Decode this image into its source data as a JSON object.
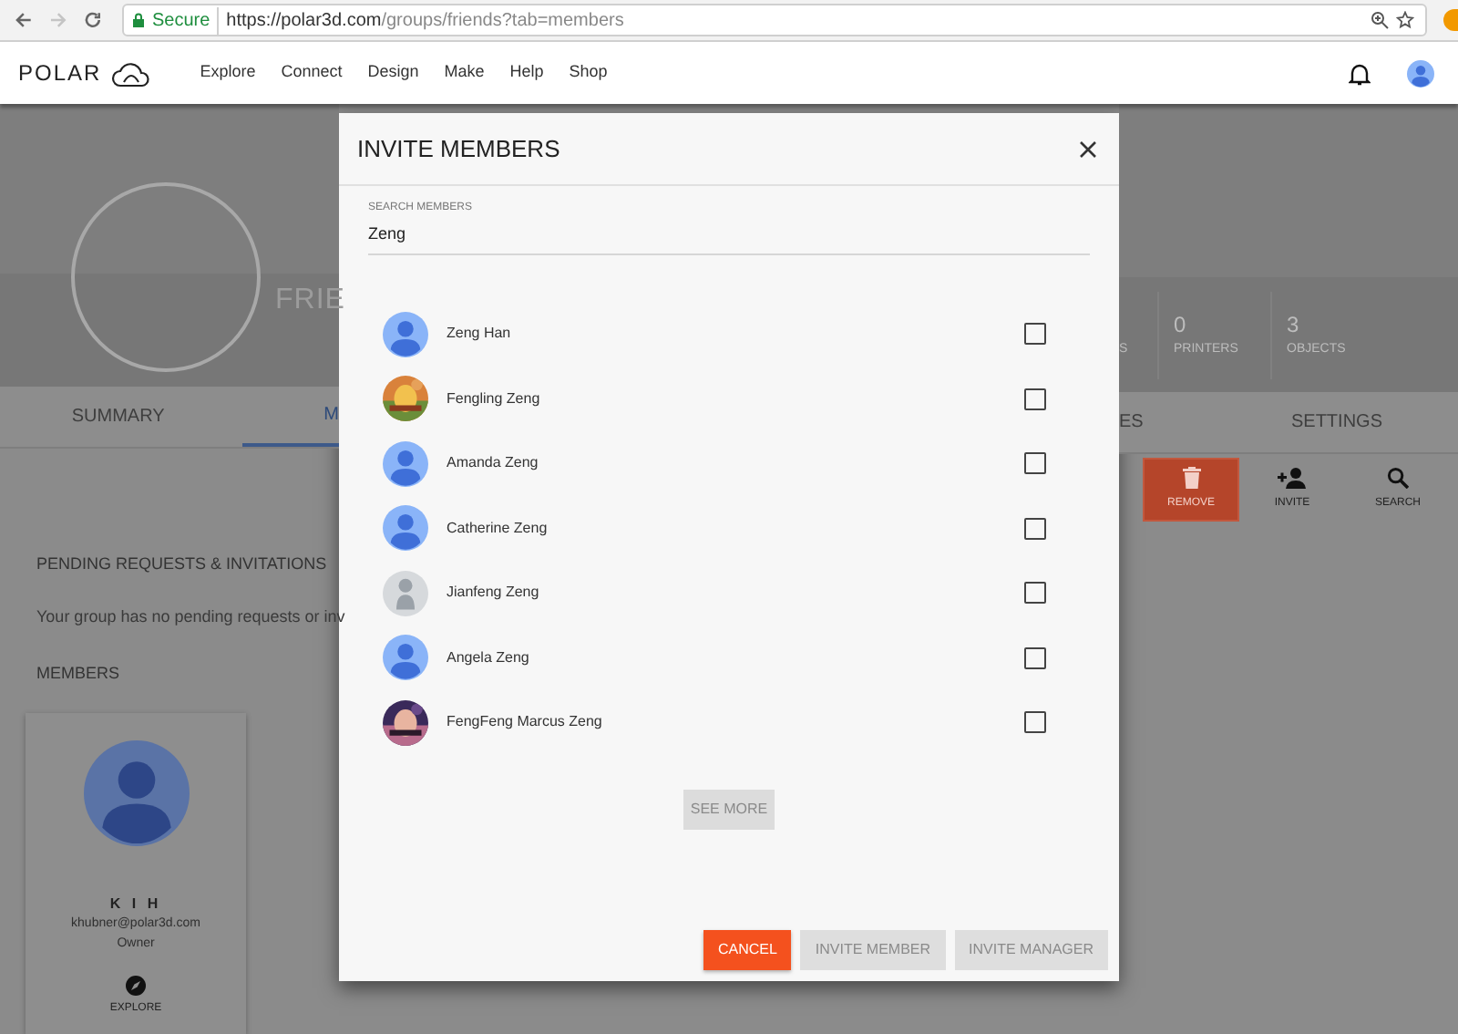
{
  "browser": {
    "secure_label": "Secure",
    "url_host": "https://polar3d.com",
    "url_path": "/groups/friends?tab=members"
  },
  "nav": {
    "logo": "POLAR",
    "links": [
      "Explore",
      "Connect",
      "Design",
      "Make",
      "Help",
      "Shop"
    ]
  },
  "group": {
    "name": "FRIE",
    "stats": [
      {
        "label": "S"
      },
      {
        "value": "0",
        "label": "PRINTERS"
      },
      {
        "value": "3",
        "label": "OBJECTS"
      }
    ]
  },
  "tabs": [
    {
      "label": "SUMMARY",
      "selected": false
    },
    {
      "label": "M",
      "selected": true
    },
    {
      "label": "ES",
      "selected": false
    },
    {
      "label": "SETTINGS",
      "selected": false
    }
  ],
  "actions": [
    {
      "label": "REMOVE",
      "kind": "remove"
    },
    {
      "label": "INVITE",
      "kind": "invite"
    },
    {
      "label": "SEARCH",
      "kind": "search"
    }
  ],
  "pending": {
    "heading": "PENDING REQUESTS & INVITATIONS",
    "text": "Your group has no pending requests or inv"
  },
  "members": {
    "heading": "MEMBERS",
    "cards": [
      {
        "name": "K I H",
        "email": "khubner@polar3d.com",
        "role": "Owner",
        "action": "EXPLORE"
      }
    ]
  },
  "dialog": {
    "title": "INVITE MEMBERS",
    "search": {
      "label": "SEARCH MEMBERS",
      "value": "Zeng"
    },
    "results": [
      {
        "name": "Zeng Han",
        "kind": "default",
        "checked": false
      },
      {
        "name": "Fengling Zeng",
        "checked": false
      },
      {
        "name": "Amanda Zeng",
        "kind": "default",
        "checked": false
      },
      {
        "name": "Catherine Zeng",
        "kind": "default",
        "checked": false
      },
      {
        "name": "Jianfeng Zeng",
        "kind": "generic",
        "checked": false
      },
      {
        "name": "Angela Zeng",
        "kind": "default",
        "checked": false
      },
      {
        "name": "FengFeng Marcus Zeng",
        "checked": false
      }
    ],
    "see_more": {
      "label": "SEE MORE",
      "disabled": true
    },
    "buttons": [
      {
        "label": "CANCEL",
        "disabled": false
      },
      {
        "label": "INVITE MEMBER",
        "disabled": true
      },
      {
        "label": "INVITE MANAGER",
        "disabled": true
      }
    ]
  }
}
